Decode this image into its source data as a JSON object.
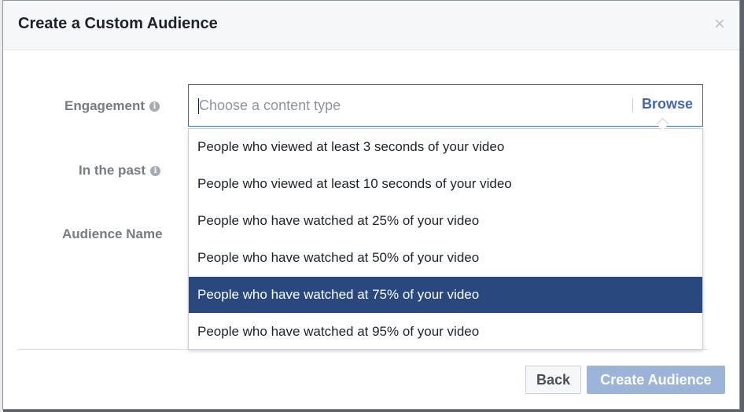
{
  "dialog": {
    "title": "Create a Custom Audience",
    "close_glyph": "×"
  },
  "form": {
    "engagement": {
      "label": "Engagement",
      "placeholder": "Choose a content type",
      "value": "",
      "browse_label": "Browse"
    },
    "in_the_past": {
      "label": "In the past"
    },
    "audience_name": {
      "label": "Audience Name"
    },
    "info_glyph": "i"
  },
  "dropdown": {
    "options": [
      {
        "label": "People who viewed at least 3 seconds of your video",
        "selected": false
      },
      {
        "label": "People who viewed at least 10 seconds of your video",
        "selected": false
      },
      {
        "label": "People who have watched at 25% of your video",
        "selected": false
      },
      {
        "label": "People who have watched at 50% of your video",
        "selected": false
      },
      {
        "label": "People who have watched at 75% of your video",
        "selected": true
      },
      {
        "label": "People who have watched at 95% of your video",
        "selected": false
      }
    ]
  },
  "footer": {
    "back_label": "Back",
    "create_label": "Create Audience",
    "create_enabled": false
  },
  "colors": {
    "accent": "#4267b2",
    "selected_row": "#29487d",
    "disabled_primary": "#9cb4d8"
  }
}
